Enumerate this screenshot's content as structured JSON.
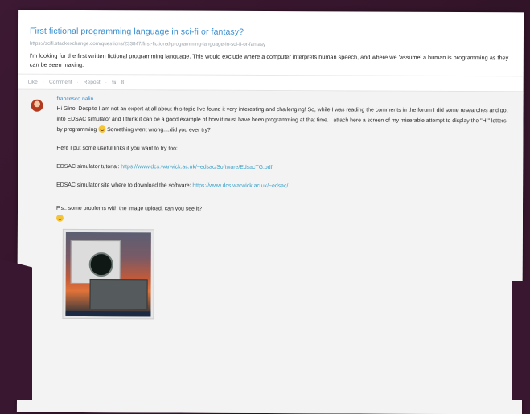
{
  "post": {
    "title": "First fictional programming language in sci-fi or fantasy?",
    "url": "https://scifi.stackexchange.com/questions/233847/first-fictional-programming-language-in-sci-fi-or-fantasy",
    "body": "I'm looking for the first written fictional programming language. This would exclude where a computer interprets human speech, and where we 'assume' a human is programming as they can be seen making."
  },
  "actions": {
    "like": "Like",
    "comment": "Comment",
    "repost": "Repost",
    "share_count": "8"
  },
  "comment": {
    "author": "francesco nalin",
    "paragraph1": "Hi Gino! Despite I am not an expert at all about this topic I've found it very interesting and challenging! So, while I was reading the comments in the forum I did some researches and got into EDSAC simulator and I think it can be a good example of how it must have been programming at that time. I attach here a screen of my miserable attempt to display the \"HI\" letters by programming",
    "paragraph1_tail": "Something went wrong....did you ever try?",
    "paragraph2": "Here I put some useful links if you want to try too:",
    "tutorial_label": "EDSAC simulator tutorial:",
    "tutorial_link": "https://www.dcs.warwick.ac.uk/~edsac/Software/EdsacTG.pdf",
    "site_label": "EDSAC simulator site where to download the software:",
    "site_link": "https://www.dcs.warwick.ac.uk/~edsac/",
    "ps": "P.s.: some problems with the image upload, can you see it?"
  },
  "colors": {
    "link": "#3a8fd0",
    "background": "#3a1730",
    "emoji": "#f4c43a"
  },
  "icons": [
    "avatar",
    "smiley-emoji-icon",
    "share-icon"
  ]
}
